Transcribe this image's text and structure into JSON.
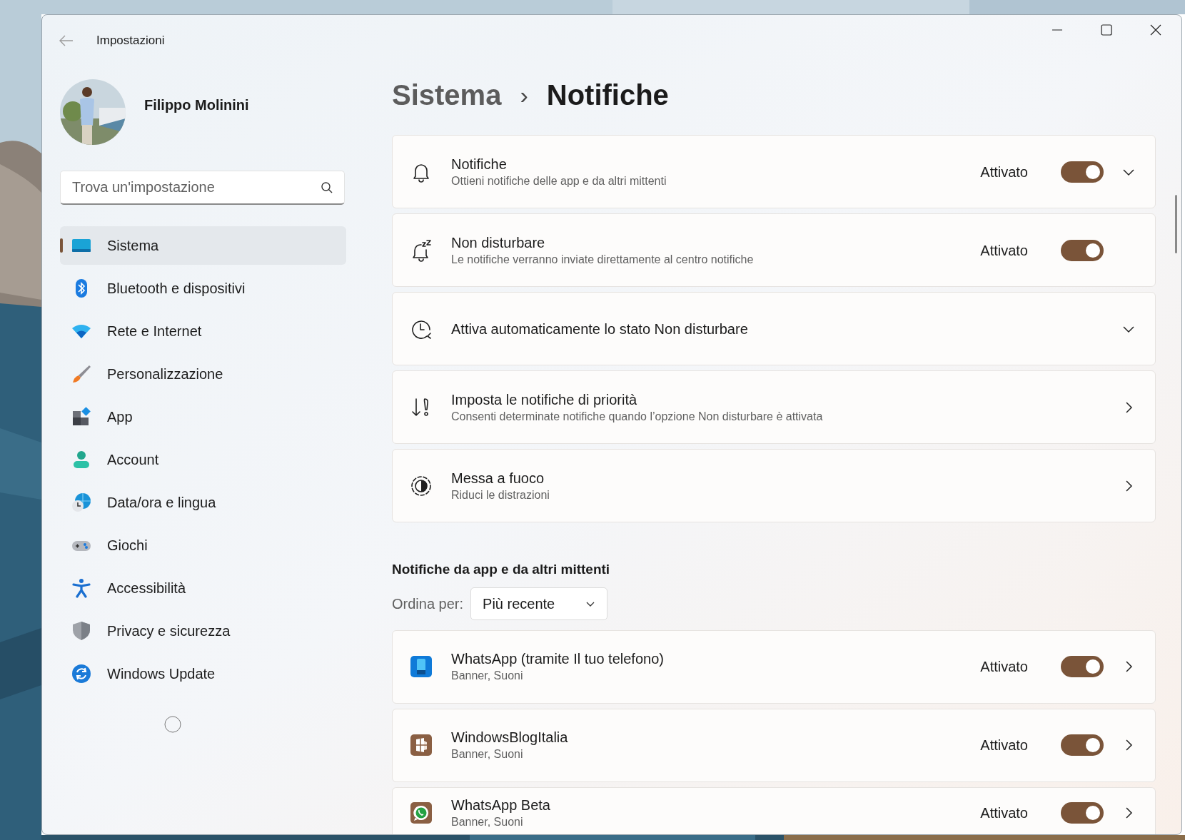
{
  "window": {
    "title": "Impostazioni"
  },
  "user": {
    "name": "Filippo Molinini"
  },
  "search": {
    "placeholder": "Trova un'impostazione"
  },
  "sidebar": {
    "items": [
      {
        "label": "Sistema",
        "selected": true
      },
      {
        "label": "Bluetooth e dispositivi",
        "selected": false
      },
      {
        "label": "Rete e Internet",
        "selected": false
      },
      {
        "label": "Personalizzazione",
        "selected": false
      },
      {
        "label": "App",
        "selected": false
      },
      {
        "label": "Account",
        "selected": false
      },
      {
        "label": "Data/ora e lingua",
        "selected": false
      },
      {
        "label": "Giochi",
        "selected": false
      },
      {
        "label": "Accessibilità",
        "selected": false
      },
      {
        "label": "Privacy e sicurezza",
        "selected": false
      },
      {
        "label": "Windows Update",
        "selected": false
      }
    ]
  },
  "breadcrumb": {
    "parent": "Sistema",
    "separator": "›",
    "current": "Notifiche"
  },
  "settings": [
    {
      "kind": "expandable",
      "title": "Notifiche",
      "subtitle": "Ottieni notifiche delle app e da altri mittenti",
      "status": "Attivato",
      "on": true,
      "expanded": false
    },
    {
      "kind": "toggle",
      "title": "Non disturbare",
      "subtitle": "Le notifiche verranno inviate direttamente al centro notifiche",
      "status": "Attivato",
      "on": true
    },
    {
      "kind": "expandable",
      "title": "Attiva automaticamente lo stato Non disturbare",
      "expanded": false
    },
    {
      "kind": "link",
      "title": "Imposta le notifiche di priorità",
      "subtitle": "Consenti determinate notifiche quando l’opzione Non disturbare è attivata"
    },
    {
      "kind": "link",
      "title": "Messa a fuoco",
      "subtitle": "Riduci le distrazioni"
    }
  ],
  "apps_section": {
    "title": "Notifiche da app e da altri mittenti",
    "sort_label": "Ordina per:",
    "sort_value": "Più recente"
  },
  "apps": [
    {
      "kind": "link",
      "title": "WhatsApp (tramite Il tuo telefono)",
      "subtitle": "Banner, Suoni",
      "status": "Attivato",
      "on": true
    },
    {
      "kind": "link",
      "title": "WindowsBlogItalia",
      "subtitle": "Banner, Suoni",
      "status": "Attivato",
      "on": true
    },
    {
      "kind": "link",
      "title": "WhatsApp Beta",
      "subtitle": "Banner, Suoni",
      "status": "Attivato",
      "on": true
    }
  ]
}
